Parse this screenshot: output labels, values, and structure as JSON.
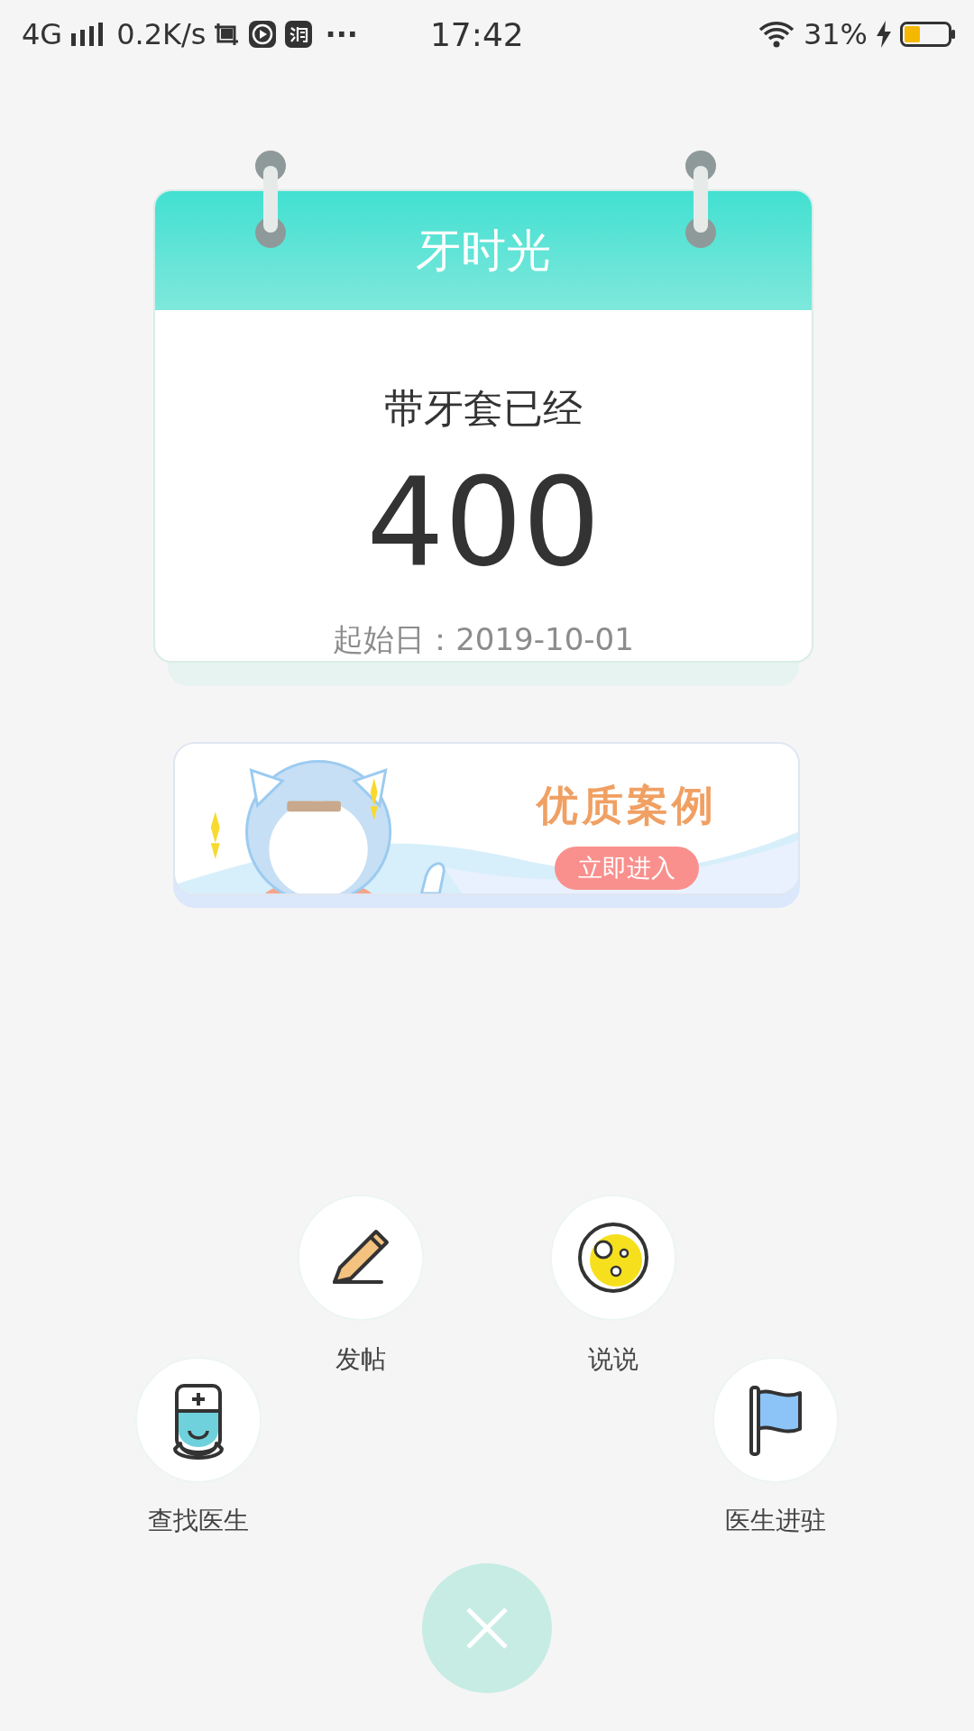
{
  "status_bar": {
    "network": "4G",
    "speed": "0.2K/s",
    "more": "···",
    "time": "17:42",
    "battery": "31%"
  },
  "calendar": {
    "title": "牙时光",
    "caption": "带牙套已经",
    "count": "400",
    "start_date": "起始日：2019-10-01"
  },
  "banner": {
    "title": "优质案例",
    "button": "立即进入"
  },
  "actions": [
    {
      "kind": "pencil",
      "label": "发帖"
    },
    {
      "kind": "moon",
      "label": "说说"
    },
    {
      "kind": "doctor",
      "label": "查找医生"
    },
    {
      "kind": "flag",
      "label": "医生进驻"
    }
  ]
}
